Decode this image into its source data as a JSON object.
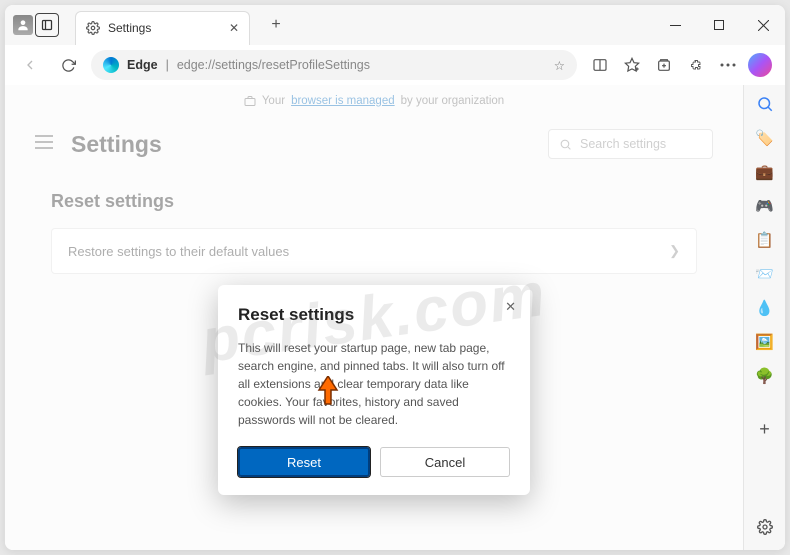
{
  "tab": {
    "title": "Settings"
  },
  "url": {
    "host": "Edge",
    "path": "edge://settings/resetProfileSettings"
  },
  "managed": {
    "prefix": "Your",
    "link": "browser is managed",
    "suffix": "by your organization"
  },
  "settings": {
    "title": "Settings",
    "search_placeholder": "Search settings",
    "section_title": "Reset settings",
    "row_label": "Restore settings to their default values"
  },
  "modal": {
    "title": "Reset settings",
    "body": "This will reset your startup page, new tab page, search engine, and pinned tabs. It will also turn off all extensions and clear temporary data like cookies. Your favorites, history and saved passwords will not be cleared.",
    "reset": "Reset",
    "cancel": "Cancel"
  },
  "watermark": "pcrisk.com"
}
